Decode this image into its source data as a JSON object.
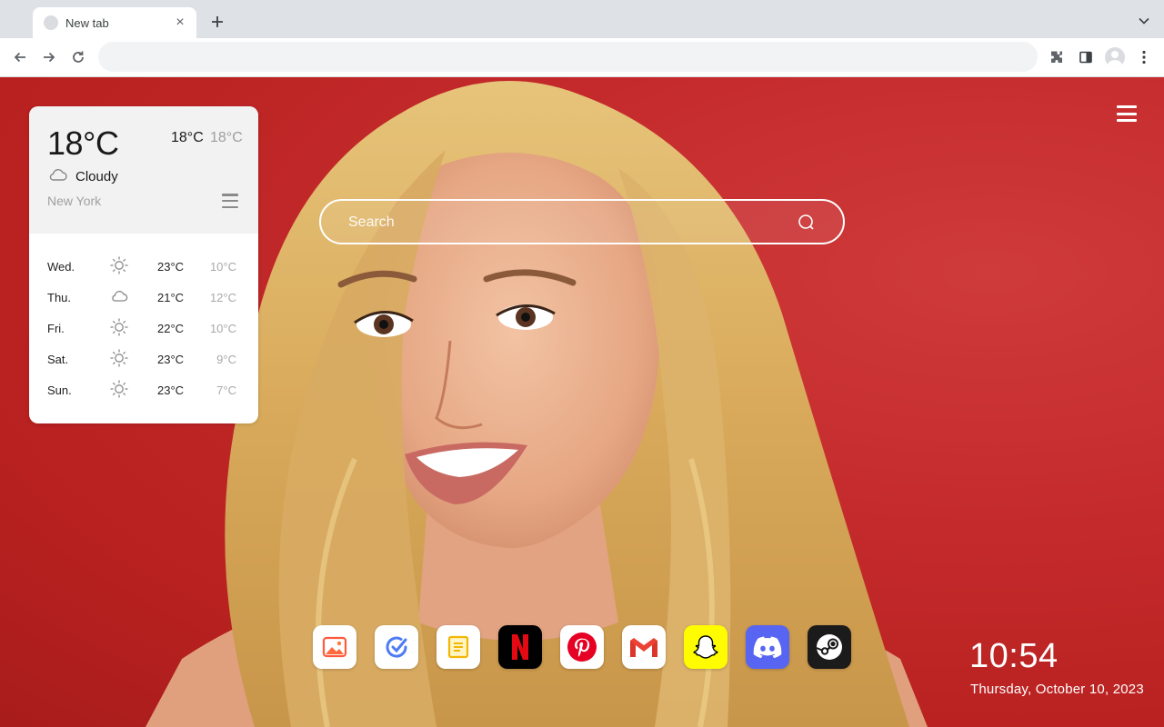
{
  "browser": {
    "tab_title": "New tab",
    "tab_close_glyph": "×",
    "new_tab_glyph": "+",
    "omnibox_value": "",
    "icons": [
      "back-arrow-icon",
      "forward-arrow-icon",
      "reload-icon",
      "extensions-puzzle-icon",
      "side-panel-icon",
      "profile-avatar-icon",
      "kebab-menu-icon",
      "tab-search-chevron-icon"
    ]
  },
  "weather": {
    "current_temp": "18°C",
    "high": "18°C",
    "low": "18°C",
    "condition": "Cloudy",
    "condition_icon": "cloud-icon",
    "city": "New York",
    "forecast": [
      {
        "day": "Wed.",
        "icon": "sun-icon",
        "high": "23°C",
        "low": "10°C"
      },
      {
        "day": "Thu.",
        "icon": "cloud-icon",
        "high": "21°C",
        "low": "12°C"
      },
      {
        "day": "Fri.",
        "icon": "sun-icon",
        "high": "22°C",
        "low": "10°C"
      },
      {
        "day": "Sat.",
        "icon": "sun-icon",
        "high": "23°C",
        "low": "9°C"
      },
      {
        "day": "Sun.",
        "icon": "sun-icon",
        "high": "23°C",
        "low": "7°C"
      }
    ]
  },
  "search": {
    "placeholder": "Search"
  },
  "dock": {
    "apps": [
      {
        "name": "gallery",
        "icon": "image-icon",
        "bg": "#ffffff"
      },
      {
        "name": "todo",
        "icon": "checkmark-circle-icon",
        "bg": "#ffffff"
      },
      {
        "name": "notes",
        "icon": "note-icon",
        "bg": "#ffffff"
      },
      {
        "name": "netflix",
        "icon": "netflix-icon",
        "bg": "#000000"
      },
      {
        "name": "pinterest",
        "icon": "pinterest-icon",
        "bg": "#ffffff"
      },
      {
        "name": "gmail",
        "icon": "gmail-icon",
        "bg": "#ffffff"
      },
      {
        "name": "snapchat",
        "icon": "snapchat-icon",
        "bg": "#fffc00"
      },
      {
        "name": "discord",
        "icon": "discord-icon",
        "bg": "#5865f2"
      },
      {
        "name": "steam",
        "icon": "steam-icon",
        "bg": "#1b1b1b"
      }
    ]
  },
  "clock": {
    "time": "10:54",
    "date": "Thursday, October 10, 2023"
  },
  "colors": {
    "background_red": "#c42a2c",
    "chrome_tabstrip": "#dee1e6",
    "omnibox": "#f1f3f4"
  }
}
